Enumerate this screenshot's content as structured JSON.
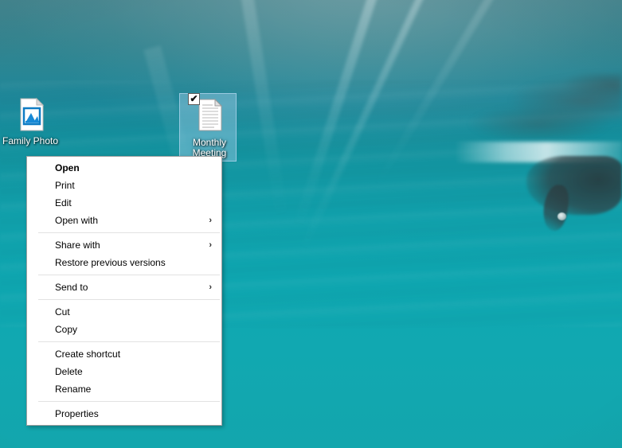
{
  "desktop": {
    "wallpaper_name": "underwater-swimmer-wallpaper",
    "background_color": "#11a0ab",
    "icons": [
      {
        "id": "family-photo",
        "label": "Family Photo",
        "icon_name": "image-file-icon",
        "selected": false,
        "checked": false
      },
      {
        "id": "monthly-meeting",
        "label": "Monthly Meeting",
        "icon_name": "text-document-icon",
        "selected": true,
        "checked": true,
        "check_glyph": "✔"
      }
    ]
  },
  "context_menu": {
    "name": "file-context-menu",
    "groups": [
      {
        "items": [
          {
            "label": "Open",
            "bold": true,
            "submenu": false
          },
          {
            "label": "Print",
            "bold": false,
            "submenu": false
          },
          {
            "label": "Edit",
            "bold": false,
            "submenu": false
          },
          {
            "label": "Open with",
            "bold": false,
            "submenu": true
          }
        ]
      },
      {
        "items": [
          {
            "label": "Share with",
            "bold": false,
            "submenu": true
          },
          {
            "label": "Restore previous versions",
            "bold": false,
            "submenu": false
          }
        ]
      },
      {
        "items": [
          {
            "label": "Send to",
            "bold": false,
            "submenu": true
          }
        ]
      },
      {
        "items": [
          {
            "label": "Cut",
            "bold": false,
            "submenu": false
          },
          {
            "label": "Copy",
            "bold": false,
            "submenu": false
          }
        ]
      },
      {
        "items": [
          {
            "label": "Create shortcut",
            "bold": false,
            "submenu": false
          },
          {
            "label": "Delete",
            "bold": false,
            "submenu": false
          },
          {
            "label": "Rename",
            "bold": false,
            "submenu": false
          }
        ]
      },
      {
        "items": [
          {
            "label": "Properties",
            "bold": false,
            "submenu": false
          }
        ]
      }
    ],
    "submenu_arrow_glyph": "›"
  }
}
